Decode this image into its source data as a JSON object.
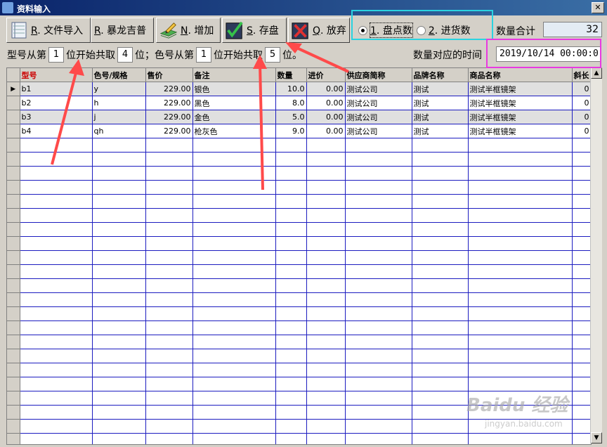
{
  "window": {
    "title": "资料输入",
    "close": "✕"
  },
  "toolbar": {
    "import_key": "R",
    "import_text": ". 文件导入",
    "baolong_key": "R",
    "baolong_text": ". 暴龙吉普",
    "add_key": "N",
    "add_text": ". 增加",
    "save_key": "S",
    "save_text": ". 存盘",
    "cancel_key": "Q",
    "cancel_text": ". 放弃"
  },
  "mode": {
    "opt1_key": "1",
    "opt1_text": ". 盘点数",
    "opt2_key": "2",
    "opt2_text": ". 进货数",
    "selected": "1"
  },
  "quantity": {
    "label": "数量合计",
    "total": "32"
  },
  "parse": {
    "model_prefix": "型号从第",
    "model_start": "1",
    "mid1": "位开始共取",
    "model_len": "4",
    "mid2": "位；色号从第",
    "color_start": "1",
    "mid3": "位开始共取",
    "color_len": "5",
    "suffix": "位。"
  },
  "time": {
    "label": "数量对应的时间",
    "value": "2019/10/14 00:00:0"
  },
  "grid": {
    "headers": [
      "型号",
      "色号/规格",
      "售价",
      "备注",
      "数量",
      "进价",
      "供应商简称",
      "品牌名称",
      "商品名称",
      "斜长"
    ],
    "rows": [
      [
        "b1",
        "y",
        "229.00",
        "银色",
        "10.0",
        "0.00",
        "测试公司",
        "测试",
        "测试半框镜架",
        "0"
      ],
      [
        "b2",
        "h",
        "229.00",
        "黑色",
        "8.0",
        "0.00",
        "测试公司",
        "测试",
        "测试半框镜架",
        "0"
      ],
      [
        "b3",
        "j",
        "229.00",
        "金色",
        "5.0",
        "0.00",
        "测试公司",
        "测试",
        "测试半框镜架",
        "0"
      ],
      [
        "b4",
        "qh",
        "229.00",
        "枪灰色",
        "9.0",
        "0.00",
        "测试公司",
        "测试",
        "测试半框镜架",
        "0"
      ]
    ],
    "current_row_marker": "▶"
  },
  "scrollbar": {
    "up": "▲",
    "down": "▼"
  },
  "watermark": {
    "main": "Baidu 经验",
    "sub": "jingyan.baidu.com"
  },
  "colors": {
    "header_red": "#cc0000",
    "grid_blue": "#1c1cc0",
    "cyan": "#2ad3e0",
    "magenta": "#e83ae0",
    "arrow": "#ff4a4a"
  }
}
